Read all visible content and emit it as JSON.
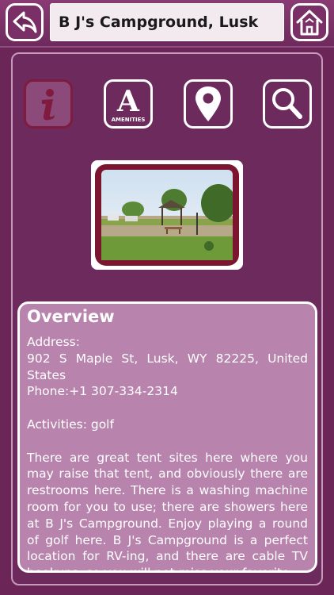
{
  "header": {
    "title": "B J's Campground, Lusk",
    "back_icon": "back-arrow-icon",
    "home_icon": "home-icon"
  },
  "toolbar": {
    "items": [
      {
        "icon": "info-icon",
        "selected": true
      },
      {
        "icon": "amenities-icon",
        "letter": "A",
        "label": "AMENITIES"
      },
      {
        "icon": "map-pin-icon"
      },
      {
        "icon": "search-icon"
      }
    ]
  },
  "photo": {
    "subject": "campground"
  },
  "overview": {
    "title": "Overview",
    "address_label": "Address:",
    "address": "902 S Maple St, Lusk, WY 82225, United States",
    "phone": "Phone:+1 307-334-2314",
    "activities": "Activities: golf",
    "description": "There are great tent sites here where you may raise that tent, and obviously there are restrooms here. There is a washing machine room for you to use; there are showers here at B J's Campground. Enjoy playing a round of golf here. B J's Campground is a perfect location for RV-ing, and there are cable TV hookups, so you will not miss your favorite"
  },
  "colors": {
    "background": "#6b2556",
    "panel_border": "#c59abb",
    "overview_bg": "#b884ad",
    "info_accent": "#7e1b3e",
    "photo_mat": "#7c1630"
  }
}
